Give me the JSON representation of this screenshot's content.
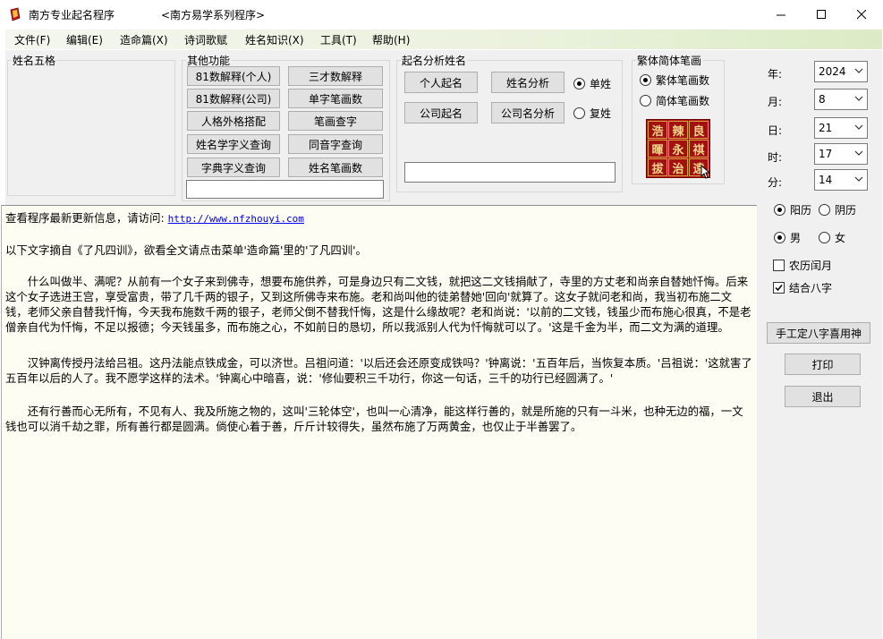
{
  "window": {
    "title": "南方专业起名程序",
    "subtitle": "<南方易学系列程序>"
  },
  "menu": [
    "文件(F)",
    "编辑(E)",
    "造命篇(X)",
    "诗词歌赋",
    "姓名知识(X)",
    "工具(T)",
    "帮助(H)"
  ],
  "groups": {
    "wuge_title": "姓名五格",
    "other_title": "其他功能",
    "analysis_title": "起名分析姓名",
    "stroke_title": "繁体简体笔画"
  },
  "other_buttons": {
    "b1": "81数解释(个人)",
    "b2": "三才数解释",
    "b3": "81数解释(公司)",
    "b4": "单字笔画数",
    "b5": "人格外格搭配",
    "b6": "笔画查字",
    "b7": "姓名学字义查询",
    "b8": "同音字查询",
    "b9": "字典字义查询",
    "b10": "姓名笔画数"
  },
  "analysis": {
    "personal_naming": "个人起名",
    "name_analysis": "姓名分析",
    "company_naming": "公司起名",
    "company_analysis": "公司名分析",
    "single_surname": "单姓",
    "compound_surname": "复姓"
  },
  "stroke": {
    "traditional": "繁体笔画数",
    "simplified": "简体笔画数",
    "callig_chars": [
      "浩",
      "辣",
      "良",
      "暉",
      "永",
      "祺",
      "拔",
      "治",
      "遠"
    ]
  },
  "datetime": {
    "year_label": "年:",
    "year": "2024",
    "month_label": "月:",
    "month": "8",
    "day_label": "日:",
    "day": "21",
    "hour_label": "时:",
    "hour": "17",
    "minute_label": "分:",
    "minute": "14"
  },
  "options": {
    "solar": "阳历",
    "lunar": "阴历",
    "male": "男",
    "female": "女",
    "leap_month": "农历闰月",
    "combine_bazi": "结合八字"
  },
  "actions": {
    "manual_bazi": "手工定八字喜用神",
    "print": "打印",
    "exit": "退出"
  },
  "content": {
    "update_prefix": "查看程序最新更新信息，请访问:",
    "update_url": "http://www.nfzhouyi.com",
    "intro": "以下文字摘自《了凡四训》，欲看全文请点击菜单'造命篇'里的'了凡四训'。",
    "para1": "　　什么叫做半、满呢？从前有一个女子来到佛寺，想要布施供养，可是身边只有二文钱，就把这二文钱捐献了，寺里的方丈老和尚亲自替她忏悔。后来这个女子选进王宫，享受富贵，带了几千两的银子，又到这所佛寺来布施。老和尚叫他的徒弟替她'回向'就算了。这女子就问老和尚，我当初布施二文钱，老师父亲自替我忏悔，今天我布施数千两的银子，老师父倒不替我忏悔，这是什么缘故呢？老和尚说：'以前的二文钱，钱虽少而布施心很真，不是老僧亲自代为忏悔，不足以报德；今天钱虽多，而布施之心，不如前日的恳切，所以我派别人代为忏悔就可以了。'这是千金为半，而二文为满的道理。",
    "para2": "　　汉钟离传授丹法给吕祖。这丹法能点铁成金，可以济世。吕祖问道：'以后还会还原变成铁吗？'钟离说：'五百年后，当恢复本质。'吕祖说：'这就害了五百年以后的人了。我不愿学这样的法术。'钟离心中暗喜，说：'修仙要积三千功行，你这一句话，三千的功行已经圆满了。'",
    "para3": "　　还有行善而心无所有，不见有人、我及所施之物的，这叫'三轮体空'，也叫一心清净，能这样行善的，就是所施的只有一斗米，也种无边的福，一文钱也可以消千劫之罪，所有善行都是圆满。倘使心着于善，斤斤计较得失，虽然布施了万两黄金，也仅止于半善罢了。"
  }
}
